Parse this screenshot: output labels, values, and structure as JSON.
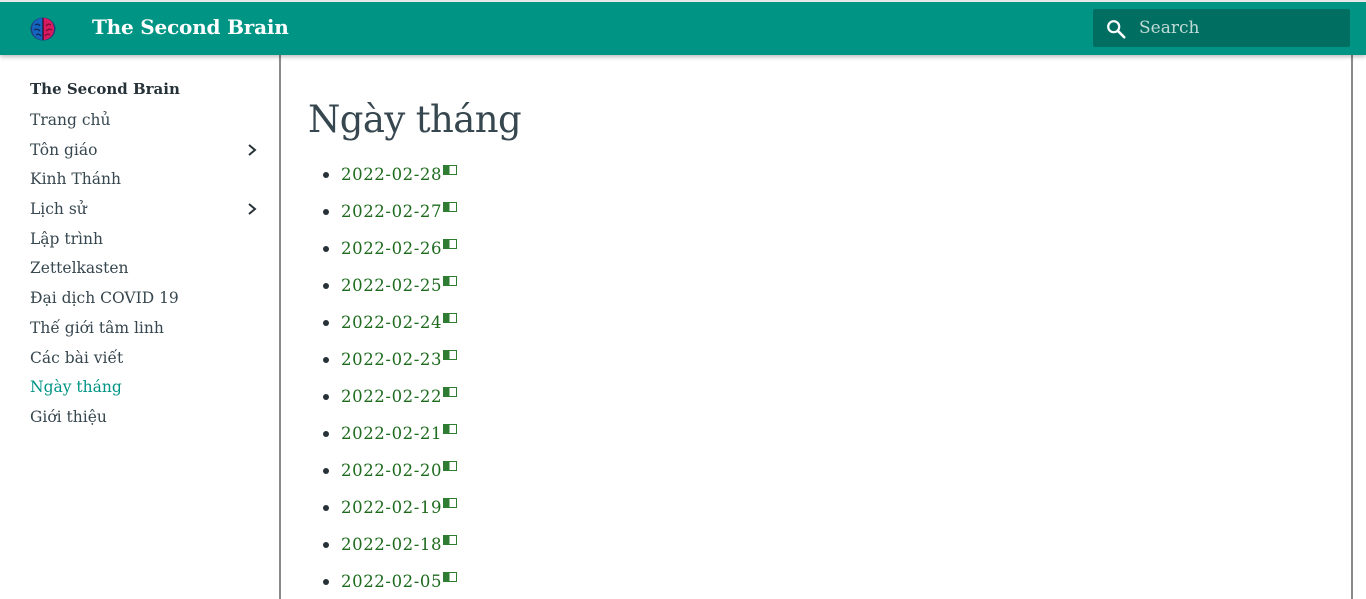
{
  "header": {
    "site_title": "The Second Brain",
    "logo_icon": "brain-icon",
    "search": {
      "placeholder": "Search",
      "value": "",
      "icon": "search-icon"
    }
  },
  "sidebar": {
    "title": "The Second Brain",
    "items": [
      {
        "label": "Trang chủ",
        "expandable": false,
        "active": false
      },
      {
        "label": "Tôn giáo",
        "expandable": true,
        "active": false
      },
      {
        "label": "Kinh Thánh",
        "expandable": false,
        "active": false
      },
      {
        "label": "Lịch sử",
        "expandable": true,
        "active": false
      },
      {
        "label": "Lập trình",
        "expandable": false,
        "active": false
      },
      {
        "label": "Zettelkasten",
        "expandable": false,
        "active": false
      },
      {
        "label": "Đại dịch COVID 19",
        "expandable": false,
        "active": false
      },
      {
        "label": "Thế giới tâm linh",
        "expandable": false,
        "active": false
      },
      {
        "label": "Các bài viết",
        "expandable": false,
        "active": false
      },
      {
        "label": "Ngày tháng",
        "expandable": false,
        "active": true
      },
      {
        "label": "Giới thiệu",
        "expandable": false,
        "active": false
      }
    ]
  },
  "main": {
    "title": "Ngày tháng",
    "entries": [
      "2022-02-28",
      "2022-02-27",
      "2022-02-26",
      "2022-02-25",
      "2022-02-24",
      "2022-02-23",
      "2022-02-22",
      "2022-02-21",
      "2022-02-20",
      "2022-02-19",
      "2022-02-18",
      "2022-02-05"
    ]
  },
  "colors": {
    "header_bg": "#009485",
    "search_bg": "#006f62",
    "active_nav": "#009485",
    "link": "#1e6b1e"
  }
}
